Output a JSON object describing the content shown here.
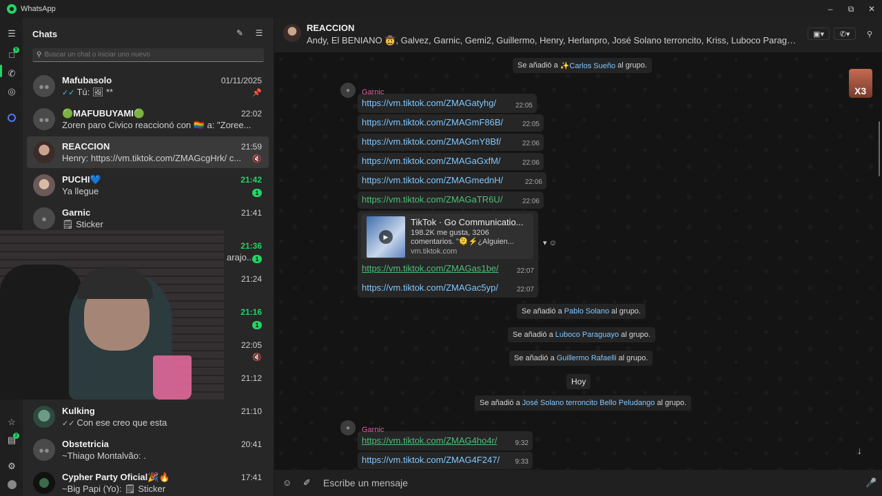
{
  "window": {
    "app_title": "WhatsApp",
    "minimize_icon": "minimize-icon",
    "maximize_icon": "maximize-icon",
    "close_icon": "close-icon"
  },
  "rail": {
    "chats_badge": "5",
    "status_badge": "2",
    "icons": [
      "menu-icon",
      "chats-icon",
      "calls-icon",
      "status-icon",
      "meta-ai-icon",
      "starred-icon",
      "archived-icon",
      "settings-icon",
      "profile-icon"
    ]
  },
  "chatlist": {
    "title": "Chats",
    "search_placeholder": "Buscar un chat o iniciar uno nuevo",
    "chats": [
      {
        "name": "Mafubasolo",
        "time": "01/11/2025",
        "preview": "Tú: 🖼 **",
        "pinned": true
      },
      {
        "name": "🟢MAFUBUYAMI🟢",
        "time": "22:02",
        "preview": "Zoren paro Civico reaccionó con 🏳️‍🌈 a: \"Zoree..."
      },
      {
        "name": "REACCION",
        "time": "21:59",
        "preview": "Henry: https://vm.tiktok.com/ZMAGcgHrk/ c...",
        "muted": true
      },
      {
        "name": "PUCHI💙",
        "time": "21:42",
        "preview": "Ya llegue",
        "unread": "1"
      },
      {
        "name": "Garnic",
        "time": "21:41",
        "preview": "🗒 Sticker"
      },
      {
        "name": "",
        "time": "21:36",
        "preview": "arajo...",
        "unread": "1"
      },
      {
        "name": "",
        "time": "21:24",
        "preview": ""
      },
      {
        "name": "",
        "time": "21:16",
        "preview": "",
        "unread": "1"
      },
      {
        "name": "",
        "time": "22:05",
        "preview": "",
        "muted": true
      },
      {
        "name": "",
        "time": "21:12",
        "preview": ""
      },
      {
        "name": "Kulking",
        "time": "21:10",
        "preview": "Con ese creo que esta"
      },
      {
        "name": "Obstetricia",
        "time": "20:41",
        "preview": "~Thiago Montalvão: ."
      },
      {
        "name": "Cypher Party Oficial🎉🔥",
        "time": "17:41",
        "preview": "~Big Papi (Yo): 🗒 Sticker"
      }
    ]
  },
  "conversation": {
    "name": "REACCION",
    "members": "Andy, El BENIANO 🤠, Galvez, Garnic, Gemi2, Guillermo, Henry, Herlanpro, José Solano terroncito, Kriss, Luboco Paragua...",
    "system_top": {
      "prefix": "Se añadió a",
      "who": "✨Carlos Sueño",
      "suffix": "al grupo."
    },
    "sender": "Garnic",
    "messages_group1": [
      {
        "link": "https://vm.tiktok.com/ZMAGatyhg/",
        "time": "22:05"
      },
      {
        "link": "https://vm.tiktok.com/ZMAGmF86B/",
        "time": "22:05"
      },
      {
        "link": "https://vm.tiktok.com/ZMAGmY8Bf/",
        "time": "22:06"
      },
      {
        "link": "https://vm.tiktok.com/ZMAGaGxfM/",
        "time": "22:06"
      },
      {
        "link": "https://vm.tiktok.com/ZMAGmednH/",
        "time": "22:06"
      },
      {
        "link": "https://vm.tiktok.com/ZMAGaTR6U/",
        "time": "22:06"
      }
    ],
    "preview": {
      "title": "TikTok · Go Communicatio...",
      "description": "198.2K me gusta, 3206 comentarios. \"🫠⚡¿Alguien...",
      "domain": "vm.tiktok.com"
    },
    "messages_group1b": [
      {
        "link": "https://vm.tiktok.com/ZMAGas1be/",
        "time": "22:07"
      },
      {
        "link": "https://vm.tiktok.com/ZMAGac5yp/",
        "time": "22:07"
      }
    ],
    "system_mid": [
      {
        "prefix": "Se añadió a",
        "who": "Pablo Solano",
        "suffix": "al grupo."
      },
      {
        "prefix": "Se añadió a",
        "who": "Luboco Paraguayo",
        "suffix": "al grupo."
      },
      {
        "prefix": "Se añadió a",
        "who": "Guillermo Rafaelli",
        "suffix": "al grupo."
      }
    ],
    "day_label": "Hoy",
    "system_bottom": {
      "prefix": "Se añadió a",
      "who": "José Solano terroncito Bello Peludango",
      "suffix": "al grupo."
    },
    "messages_group2": [
      {
        "link": "https://vm.tiktok.com/ZMAG4ho4r/",
        "time": "9:32"
      },
      {
        "link": "https://vm.tiktok.com/ZMAG4F247/",
        "time": "9:33"
      }
    ],
    "sticker_text": "X3",
    "composer_placeholder": "Escribe un mensaje"
  },
  "colors": {
    "accent": "#25d366",
    "link": "#7fc7ff",
    "sender": "#e25fa4"
  }
}
